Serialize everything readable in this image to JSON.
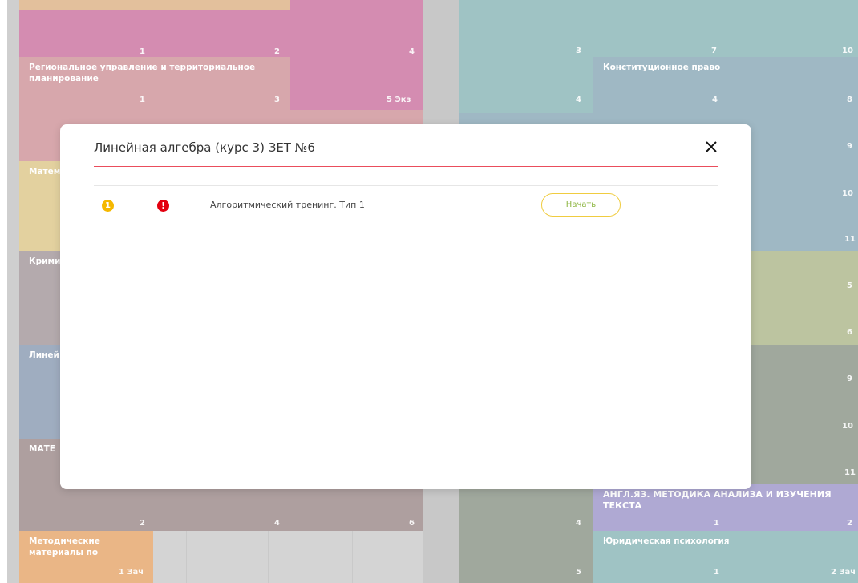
{
  "modal": {
    "title": "Линейная алгебра (курс 3) ЗЕТ №6",
    "task": {
      "number_badge": "1",
      "alert_badge": "!",
      "label": "Алгоритмический тренинг. Тип 1",
      "start_label": "Начать"
    }
  },
  "background_tiles": {
    "regional": {
      "title": "Региональное управление и территориальное планирование",
      "nums": [
        "1",
        "3",
        "5 Экз"
      ]
    },
    "pink_top_row": [
      "1",
      "2",
      "4"
    ],
    "teal_top_row": [
      "3",
      "7",
      "10"
    ],
    "constitutional": {
      "title": "Конституционное право",
      "nums": [
        "4",
        "8"
      ],
      "left_num": "4"
    },
    "left_math_partial": "Матем",
    "left_crim_partial": "Крими",
    "left_lin_partial": "Линей",
    "left_mate_partial": "МАТЕ",
    "right_steel_nums": [
      "9",
      "10",
      "11"
    ],
    "right_olive_nums": [
      "5",
      "6"
    ],
    "right_gray_nums": [
      "9",
      "10",
      "11"
    ],
    "bottom_row_nums": [
      "2",
      "4",
      "6"
    ],
    "bottom_mid_num": "4",
    "english": {
      "title": "АНГЛ.ЯЗ. МЕТОДИКА АНАЛИЗА И ИЗУЧЕНИЯ ТЕКСТА",
      "nums": [
        "1",
        "2"
      ]
    },
    "methodical": {
      "title": "Методические материалы по",
      "num": "1 Зач"
    },
    "bottom_mid_num2": "5",
    "legal_psych": {
      "title": "Юридическая психология",
      "nums": [
        "1",
        "2 Зач"
      ]
    }
  },
  "colors": {
    "pink": "#c46093",
    "teal": "#7aacad",
    "steel": "#7b9dae",
    "olive": "#a3ad7c",
    "gray_green": "#7c8778",
    "purple": "#9188c2",
    "orange": "#e29a58",
    "accent_red": "#ea4d5c",
    "badge_yellow": "#f5b800",
    "badge_red": "#e3000f",
    "button_text": "#8cb53f"
  }
}
